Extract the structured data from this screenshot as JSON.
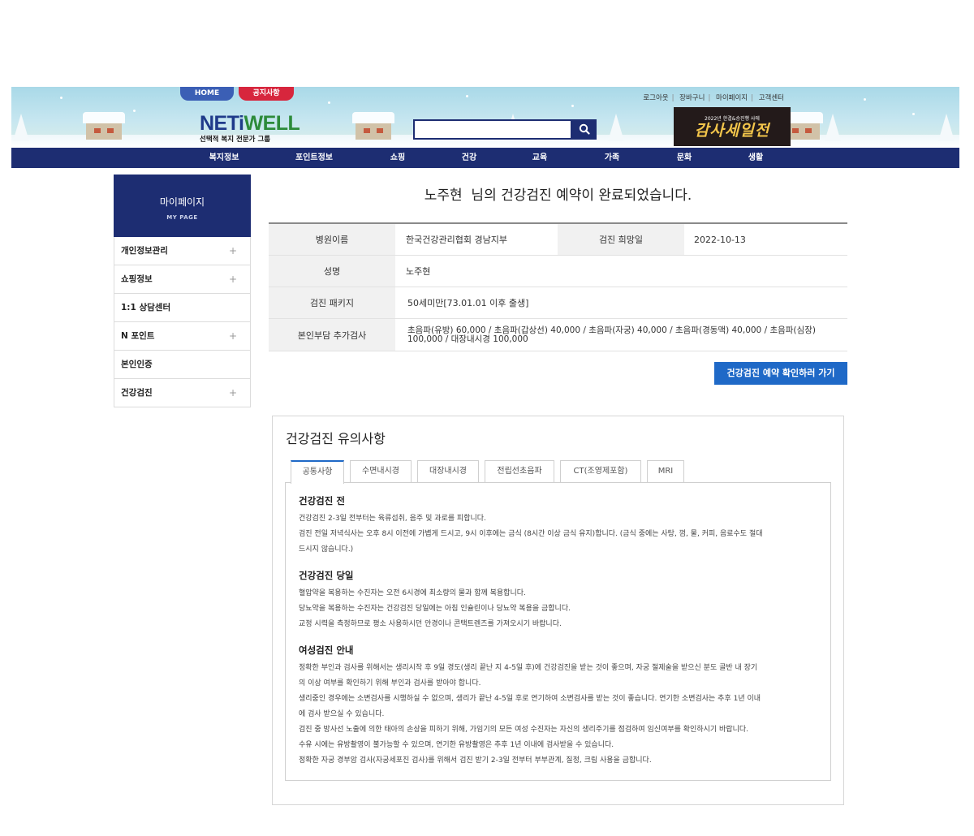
{
  "header": {
    "tab_home": "HOME",
    "tab_notice": "공지사항",
    "logo_main_1": "NETi",
    "logo_main_2": "WELL",
    "logo_sub": "선택적 복지 전문가 그룹",
    "search_placeholder": "",
    "search_icon": "search-icon",
    "util_links": [
      "로그아웃",
      "장바구니",
      "마이페이지",
      "고객센터"
    ],
    "sale_top": "2022년 한결&승진행 사에",
    "sale_main": "감사세일전",
    "gnb": [
      "복지정보",
      "포인트정보",
      "쇼핑",
      "건강",
      "교육",
      "가족",
      "문화",
      "생활"
    ]
  },
  "sidebar": {
    "title": "마이페이지",
    "subtitle": "MY PAGE",
    "items": [
      {
        "label": "개인정보관리",
        "plus": "+"
      },
      {
        "label": "쇼핑정보",
        "plus": "+"
      },
      {
        "label": "1:1 상담센터",
        "plus": ""
      },
      {
        "label": "N 포인트",
        "plus": "+"
      },
      {
        "label": "본인인증",
        "plus": ""
      },
      {
        "label": "건강검진",
        "plus": "+"
      }
    ]
  },
  "main": {
    "title": "노주현  님의 건강검진 예약이 완료되었습니다.",
    "table": {
      "hospital_label": "병원이름",
      "hospital_value": "한국건강관리협회 경남지부",
      "date_label": "검진 희망일",
      "date_value": "2022-10-13",
      "name_label": "성명",
      "name_value": "노주현",
      "package_label": "검진 패키지",
      "package_value": "50세미만[73.01.01 이후 출생]",
      "extra_label": "본인부담 추가검사",
      "extra_value": "초음파(유방) 60,000 / 초음파(갑상선) 40,000 / 초음파(자궁) 40,000 / 초음파(경동맥) 40,000 / 초음파(심장) 100,000 / 대장내시경 100,000"
    },
    "confirm_button": "건강검진 예약 확인하러 가기"
  },
  "notice": {
    "title": "건강검진 유의사항",
    "tabs": [
      "공통사항",
      "수면내시경",
      "대장내시경",
      "전립선초음파",
      "CT(조영제포함)",
      "MRI"
    ],
    "sections": [
      {
        "title": "건강검진 전",
        "lines": [
          "건강검진 2-3일 전부터는 육류섭취, 음주 및 과로를 피합니다.",
          "검진 전일 저녁식사는 오후 8시 이전에 가볍게 드시고, 9시 이후에는 금식 (8시간 이상 금식 유지)합니다. (금식 중에는 사탕, 껌, 물, 커피, 음료수도 절대",
          "드시지 않습니다.)"
        ]
      },
      {
        "title": "건강검진 당일",
        "lines": [
          "혈압약을 복용하는 수진자는 오전 6시경에 최소량의 물과 함께 복용합니다.",
          "당뇨약을 복용하는 수진자는 건강검진 당일에는 아침 인슐린이나 당뇨약 복용을 금합니다.",
          "교정 시력을 측정하므로 평소 사용하시던 안경이나 콘택트렌즈를 가져오시기 바랍니다."
        ]
      },
      {
        "title": "여성검진 안내",
        "lines": [
          "정확한 부인과 검사를 위해서는 생리시작 후 9일 경도(생리 끝난 지 4-5일 후)에 건강검진을 받는 것이 좋으며, 자궁 절제술을 받으신 분도 골반 내 장기",
          "의 이상 여부를 확인하기 위해 부인과 검사를 받아야 합니다.",
          "생리중인 경우에는 소변검사를 시행하실 수 없으며, 생리가 끝난 4-5일 후로 연기하여 소변검사를 받는 것이 좋습니다. 연기한 소변검사는 추후 1년 이내",
          "에 검사 받으실 수 있습니다.",
          "검진 중 방사선 노출에 의한 태아의 손상을 피하기 위해, 가임기의 모든 여성 수진자는 자신의 생리주기를 점검하여 임신여부를 확인하시기 바랍니다.",
          "수유 시에는 유방촬영이 불가능할 수 있으며, 연기한 유방촬영은 추후 1년 이내에 검사받을 수 있습니다.",
          "정확한 자궁 경부암 검사(자궁세포진 검사)를 위해서 검진 받기 2-3일 전부터 부부관계, 질정, 크림 사용을 금합니다."
        ]
      }
    ]
  }
}
